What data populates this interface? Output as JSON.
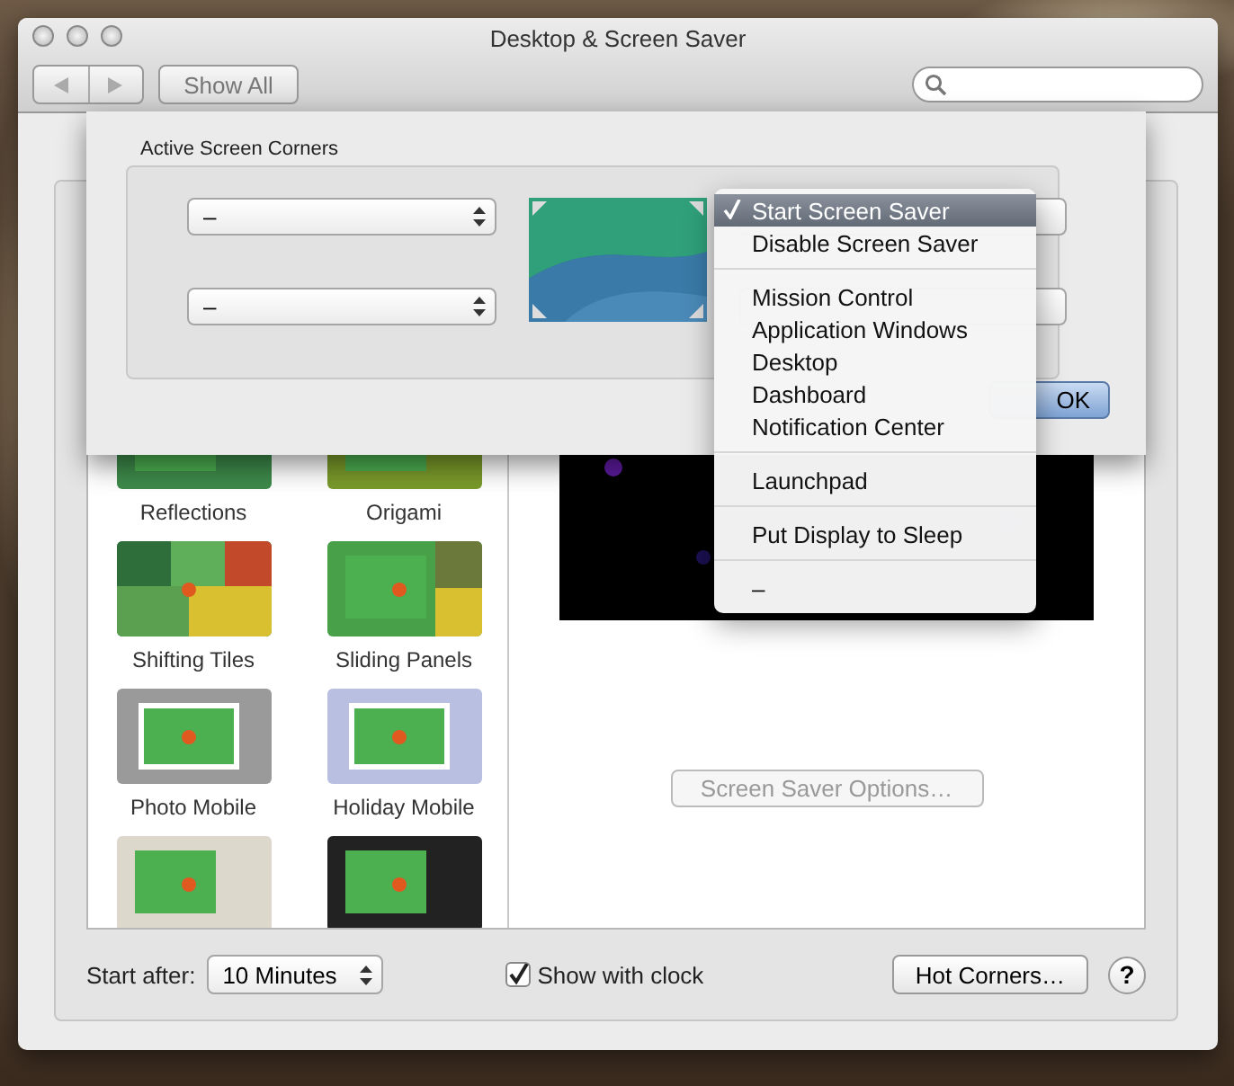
{
  "window": {
    "title": "Desktop & Screen Saver"
  },
  "toolbar": {
    "show_all": "Show All"
  },
  "screen_savers": [
    {
      "kind": "saver",
      "label": "Reflections"
    },
    {
      "kind": "saver",
      "label": "Origami"
    },
    {
      "kind": "saver",
      "label": "Shifting Tiles"
    },
    {
      "kind": "saver",
      "label": "Sliding Panels"
    },
    {
      "kind": "saver",
      "label": "Photo Mobile"
    },
    {
      "kind": "saver",
      "label": "Holiday Mobile"
    },
    {
      "kind": "picture"
    },
    {
      "kind": "picture"
    }
  ],
  "options_button": {
    "label": "Screen Saver Options…",
    "disabled": true
  },
  "bottom_bar": {
    "start_after_label": "Start after:",
    "start_after_value": "10 Minutes",
    "show_with_clock": {
      "label": "Show with clock",
      "checked": true
    },
    "hot_corners": "Hot Corners…",
    "help": "?"
  },
  "sheet": {
    "title": "Active Screen Corners",
    "top_left": "–",
    "bottom_left": "–",
    "ok": "OK"
  },
  "corner_menu": [
    {
      "kind": "item",
      "label": "Start Screen Saver",
      "checked": true,
      "selected": true
    },
    {
      "kind": "item",
      "label": "Disable Screen Saver",
      "checked": false,
      "selected": false
    },
    {
      "kind": "separator"
    },
    {
      "kind": "item",
      "label": "Mission Control",
      "checked": false,
      "selected": false
    },
    {
      "kind": "item",
      "label": "Application Windows",
      "checked": false,
      "selected": false
    },
    {
      "kind": "item",
      "label": "Desktop",
      "checked": false,
      "selected": false
    },
    {
      "kind": "item",
      "label": "Dashboard",
      "checked": false,
      "selected": false
    },
    {
      "kind": "item",
      "label": "Notification Center",
      "checked": false,
      "selected": false
    },
    {
      "kind": "separator"
    },
    {
      "kind": "item",
      "label": "Launchpad",
      "checked": false,
      "selected": false
    },
    {
      "kind": "separator"
    },
    {
      "kind": "item",
      "label": "Put Display to Sleep",
      "checked": false,
      "selected": false
    },
    {
      "kind": "separator"
    },
    {
      "kind": "item",
      "label": "–",
      "checked": false,
      "selected": false
    }
  ]
}
